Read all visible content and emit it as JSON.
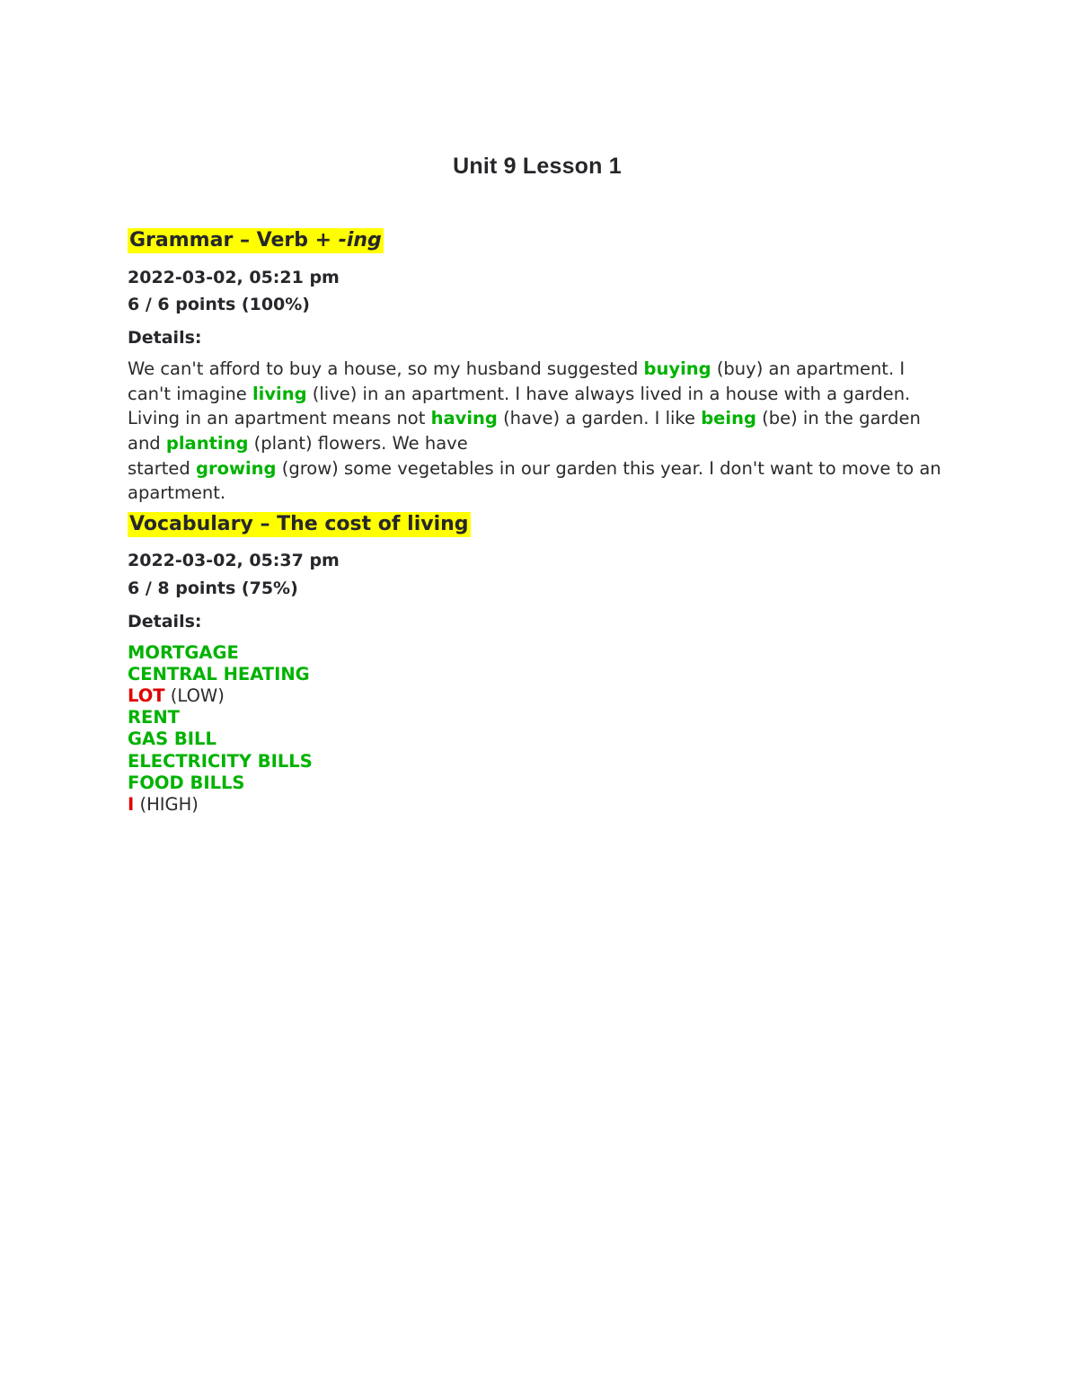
{
  "document": {
    "title": "Unit 9 Lesson 1",
    "background_color": "#ffffff",
    "text_color": "#26272b",
    "highlight_color": "#ffff00",
    "correct_color": "#00b200",
    "incorrect_color": "#e00000"
  },
  "sections": [
    {
      "id": "grammar",
      "heading_prefix": "Grammar – Verb + ",
      "heading_suffix_italic": "-ing",
      "heading_full": "Grammar – Verb + -ing",
      "timestamp": "2022-03-02, 05:21 pm",
      "score": "6 / 6 points (100%)",
      "points_earned": 6,
      "points_total": 6,
      "percent": "100%",
      "details_label": "Details:",
      "answer_type": "paragraph",
      "paragraph_runs": [
        {
          "text": "We can't afford to buy a house, so my husband suggested ",
          "style": "plain"
        },
        {
          "text": "buying",
          "style": "correct"
        },
        {
          "text": " (buy) an apartment. I can't imagine ",
          "style": "plain"
        },
        {
          "text": "living",
          "style": "correct"
        },
        {
          "text": " (live) in an apartment. I have always lived in a house with a garden. Living in an apartment means not ",
          "style": "plain"
        },
        {
          "text": "having",
          "style": "correct"
        },
        {
          "text": " (have) a garden. I like ",
          "style": "plain"
        },
        {
          "text": "being",
          "style": "correct"
        },
        {
          "text": " (be) in the garden and ",
          "style": "plain"
        },
        {
          "text": "planting",
          "style": "correct"
        },
        {
          "text": " (plant) flowers. We have",
          "style": "plain"
        },
        {
          "text": "\n",
          "style": "break"
        },
        {
          "text": "started ",
          "style": "plain"
        },
        {
          "text": "growing",
          "style": "correct"
        },
        {
          "text": " (grow) some vegetables in our garden this year. I don't want to move to an apartment.",
          "style": "plain"
        }
      ]
    },
    {
      "id": "vocabulary",
      "heading_prefix": "Vocabulary – The cost of living",
      "heading_suffix_italic": "",
      "heading_full": "Vocabulary – The cost of living",
      "timestamp": "2022-03-02, 05:37 pm",
      "score": "6 / 8 points (75%)",
      "points_earned": 6,
      "points_total": 8,
      "percent": "75%",
      "details_label": "Details:",
      "answer_type": "word-list",
      "words": [
        {
          "answer": "MORTGAGE",
          "note": "",
          "status": "correct"
        },
        {
          "answer": "CENTRAL HEATING",
          "note": "",
          "status": "correct"
        },
        {
          "answer": "LOT",
          "note": " (LOW)",
          "status": "incorrect"
        },
        {
          "answer": "RENT",
          "note": "",
          "status": "correct"
        },
        {
          "answer": "GAS BILL",
          "note": "",
          "status": "correct"
        },
        {
          "answer": "ELECTRICITY BILLS",
          "note": "",
          "status": "correct"
        },
        {
          "answer": "FOOD BILLS",
          "note": "",
          "status": "correct"
        },
        {
          "answer": "I",
          "note": " (HIGH)",
          "status": "incorrect"
        }
      ]
    }
  ]
}
